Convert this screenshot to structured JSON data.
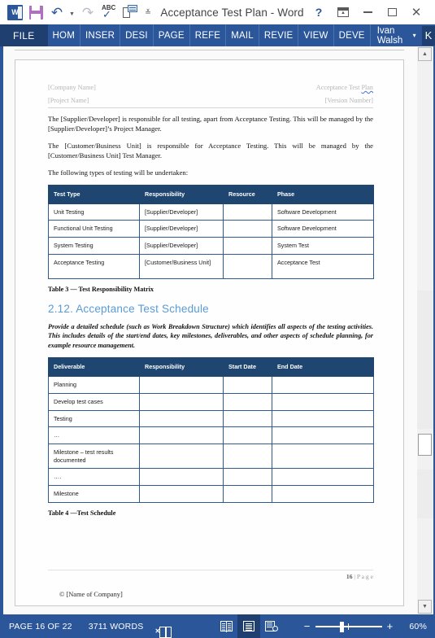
{
  "window": {
    "title": "Acceptance Test Plan - Word",
    "quick_access": [
      {
        "name": "word-logo-icon",
        "label": "W"
      },
      {
        "name": "save-icon",
        "label": "Save"
      },
      {
        "name": "undo-icon",
        "label": "Undo"
      },
      {
        "name": "redo-icon",
        "label": "Redo"
      },
      {
        "name": "spelling-grammar-icon",
        "label": "ABC"
      },
      {
        "name": "print-preview-icon",
        "label": "Print Preview and Print"
      },
      {
        "name": "customize-qat-icon",
        "label": "Customize Quick Access Toolbar"
      }
    ],
    "controls": [
      {
        "name": "help-button",
        "label": "?"
      },
      {
        "name": "ribbon-display-options-button",
        "label": "Ribbon Display Options"
      },
      {
        "name": "minimize-button",
        "label": "Minimize"
      },
      {
        "name": "maximize-button",
        "label": "Maximize"
      },
      {
        "name": "close-button",
        "label": "Close"
      }
    ]
  },
  "ribbon": {
    "file_tab": "FILE",
    "tabs": [
      "HOM",
      "INSER",
      "DESI",
      "PAGE",
      "REFE",
      "MAIL",
      "REVIE",
      "VIEW",
      "DEVE"
    ],
    "account_name": "Ivan Walsh",
    "account_caret": "▾",
    "avatar_initial": "K",
    "accent_color": "#2B579A",
    "file_tab_color": "#1E3F6F"
  },
  "document": {
    "header": {
      "left_line1": "[Company Name]",
      "right_line1_plain": "Acceptance Test ",
      "right_line1_misspelled": "Plan",
      "left_line2": "[Project Name]",
      "right_line2": "[Version Number]"
    },
    "paragraphs": [
      "The [Supplier/Developer] is responsible for all testing, apart from Acceptance Testing. This will be managed by the [Supplier/Developer]’s Project Manager.",
      "The [Customer/Business Unit] is responsible for Acceptance Testing. This will be managed by the [Customer/Business Unit] Test Manager.",
      "The following types of testing will be undertaken:"
    ],
    "table_responsibility": {
      "columns": [
        "Test Type",
        "Responsibility",
        "Resource",
        "Phase"
      ],
      "rows": [
        [
          "Unit Testing",
          "[Supplier/Developer]",
          "",
          "Software Development"
        ],
        [
          "Functional Unit Testing",
          "[Supplier/Developer]",
          "",
          "Software Development"
        ],
        [
          "System Testing",
          "[Supplier/Developer]",
          "",
          "System Test"
        ],
        [
          "Acceptance Testing",
          "[Customer/Business Unit]",
          "",
          "Acceptance Test"
        ]
      ],
      "caption": "Table 3 — Test Responsibility Matrix",
      "header_color": "#1F4671"
    },
    "section_heading": "2.12. Acceptance Test Schedule",
    "section_heading_color": "#5B9BD5",
    "section_intro": "Provide a detailed schedule (such as Work Breakdown Structure) which identifies all aspects of the testing activities. This includes details of the start/end dates, key milestones, deliverables, and other aspects of schedule planning, for example resource management.",
    "table_schedule": {
      "columns": [
        "Deliverable",
        "Responsibility",
        "Start Date",
        "End Date"
      ],
      "rows": [
        [
          "Planning",
          "",
          "",
          ""
        ],
        [
          "Develop test cases",
          "",
          "",
          ""
        ],
        [
          "Testing",
          "",
          "",
          ""
        ],
        [
          "…",
          "",
          "",
          ""
        ],
        [
          "Milestone – test results documented",
          "",
          "",
          ""
        ],
        [
          "….",
          "",
          "",
          ""
        ],
        [
          "Milestone",
          "",
          "",
          ""
        ]
      ],
      "caption": "Table 4 —Test Schedule"
    },
    "footer": {
      "page_number": "16",
      "page_label": "| P a g e",
      "copyright": "© [Name of Company]"
    }
  },
  "statusbar": {
    "page_indicator": "PAGE 16 OF 22",
    "word_count": "3711 WORDS",
    "proofing_icon": "proofing-errors-icon",
    "views": [
      {
        "name": "read-mode-button",
        "label": "Read Mode",
        "active": false
      },
      {
        "name": "print-layout-button",
        "label": "Print Layout",
        "active": true
      },
      {
        "name": "web-layout-button",
        "label": "Web Layout",
        "active": false
      }
    ],
    "zoom_out": "−",
    "zoom_in": "+",
    "zoom_level": "60%"
  },
  "scrollbar": {
    "up_arrow": "▲",
    "down_arrow": "▼"
  }
}
